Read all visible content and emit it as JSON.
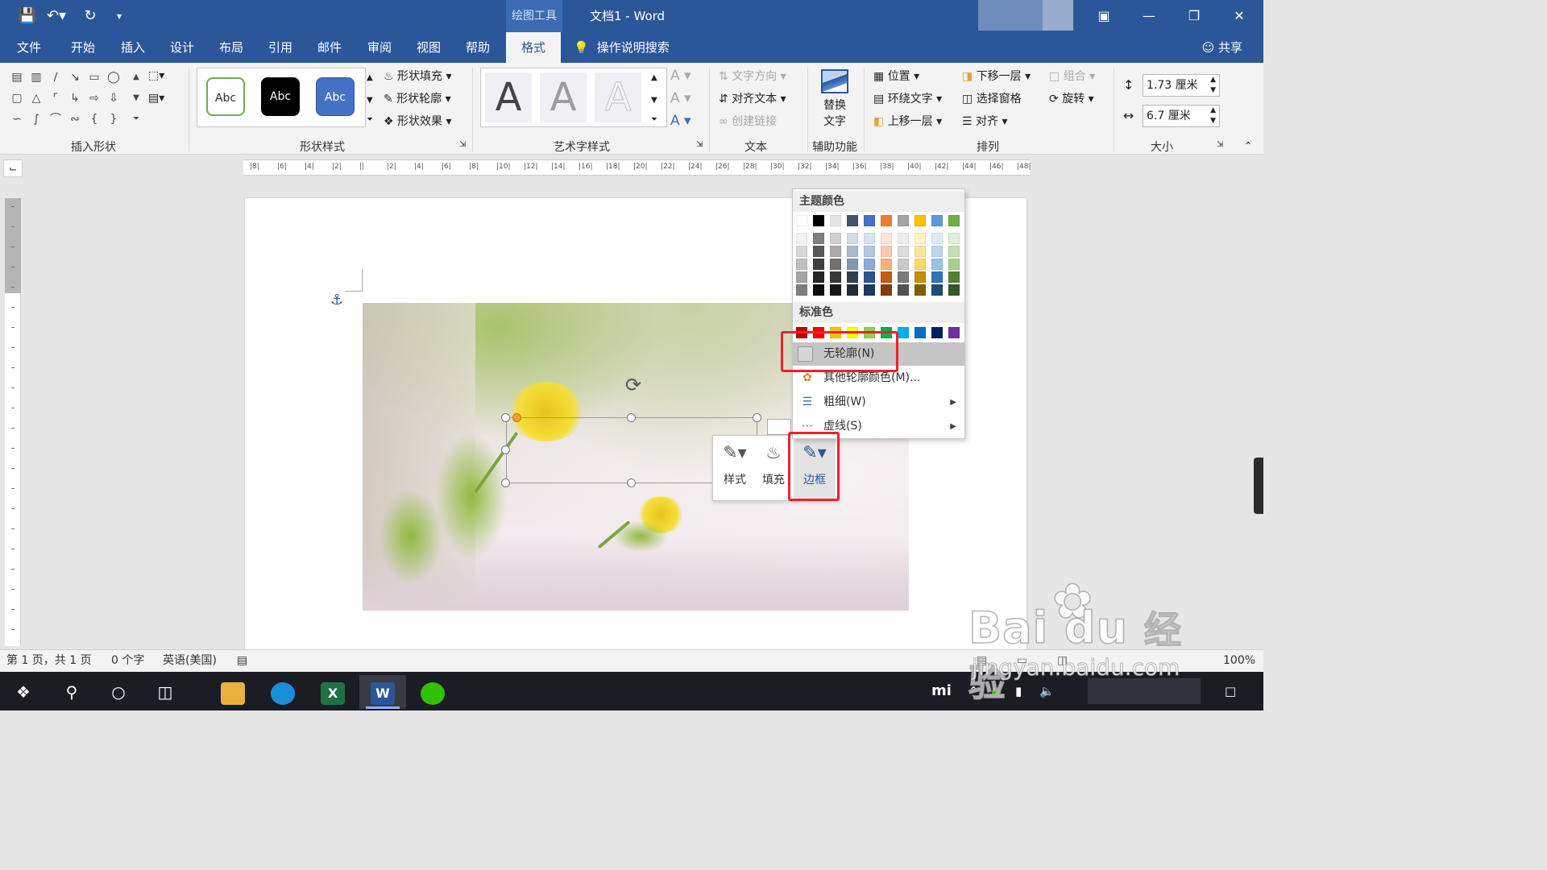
{
  "titlebar": {
    "quick_access": [
      "save-icon",
      "undo-icon",
      "redo-icon",
      "customize-icon"
    ],
    "context_group": "绘图工具",
    "doc_title": "文档1  -  Word"
  },
  "tabs": [
    {
      "label": "文件"
    },
    {
      "label": "开始"
    },
    {
      "label": "插入"
    },
    {
      "label": "设计"
    },
    {
      "label": "布局"
    },
    {
      "label": "引用"
    },
    {
      "label": "邮件"
    },
    {
      "label": "审阅"
    },
    {
      "label": "视图"
    },
    {
      "label": "帮助"
    },
    {
      "label": "格式",
      "active": true
    }
  ],
  "tellme": "操作说明搜索",
  "share": "共享",
  "ribbon": {
    "groups": {
      "insert_shapes": "插入形状",
      "shape_styles": "形状样式",
      "wordart": "艺术字样式",
      "text": "文本",
      "accessibility": "辅助功能",
      "arrange": "排列",
      "size": "大小"
    },
    "style_presets": [
      "Abc",
      "Abc",
      "Abc"
    ],
    "shape_fill": "形状填充",
    "shape_outline": "形状轮廓",
    "shape_effects": "形状效果",
    "text_direction": "文字方向",
    "align_text": "对齐文本",
    "create_link": "创建链接",
    "alt_text_1": "替换",
    "alt_text_2": "文字",
    "position": "位置",
    "wrap_text": "环绕文字",
    "bring_forward": "上移一层",
    "send_backward": "下移一层",
    "selection_pane": "选择窗格",
    "align": "对齐",
    "group": "组合",
    "rotate": "旋转",
    "height": "1.73 厘米",
    "width": "6.7 厘米"
  },
  "ruler_labels": [
    "8",
    "6",
    "4",
    "2",
    "",
    "2",
    "4",
    "6",
    "8",
    "10",
    "12",
    "14",
    "16",
    "18",
    "20",
    "22",
    "24",
    "26",
    "28",
    "30",
    "32",
    "34",
    "36",
    "38",
    "40",
    "42",
    "44",
    "46",
    "48"
  ],
  "mini_toolbar": {
    "style": "样式",
    "fill": "填充",
    "border": "边框"
  },
  "outline_menu": {
    "theme_colors_label": "主题颜色",
    "standard_colors_label": "标准色",
    "theme_top": [
      "#ffffff",
      "#000000",
      "#e7e6e6",
      "#44546a",
      "#4472c4",
      "#ed7d31",
      "#a5a5a5",
      "#ffc000",
      "#5b9bd5",
      "#70ad47"
    ],
    "theme_shades": [
      [
        "#f2f2f2",
        "#7f7f7f",
        "#d0cece",
        "#d6dce4",
        "#d9e2f3",
        "#fbe5d5",
        "#ededed",
        "#fff2cc",
        "#deebf6",
        "#e2efd9"
      ],
      [
        "#d8d8d8",
        "#595959",
        "#aeaaaa",
        "#adb9ca",
        "#b4c6e7",
        "#f7cbac",
        "#dbdbdb",
        "#fee599",
        "#bdd7ee",
        "#c5e0b3"
      ],
      [
        "#bfbfbf",
        "#3f3f3f",
        "#757070",
        "#8496b0",
        "#8eaadb",
        "#f4b183",
        "#c9c9c9",
        "#ffd965",
        "#9cc3e5",
        "#a8d08d"
      ],
      [
        "#a5a5a5",
        "#262626",
        "#3a3838",
        "#323f4f",
        "#2f5496",
        "#c55a11",
        "#7b7b7b",
        "#bf9000",
        "#2e75b5",
        "#538135"
      ],
      [
        "#7f7f7f",
        "#0c0c0c",
        "#171616",
        "#222a35",
        "#1f3864",
        "#833c0b",
        "#525252",
        "#7f6000",
        "#1e4e79",
        "#375623"
      ]
    ],
    "standard": [
      "#c00000",
      "#ff0000",
      "#ffc000",
      "#ffff00",
      "#92d050",
      "#00b050",
      "#00b0f0",
      "#0070c0",
      "#002060",
      "#7030a0"
    ],
    "no_outline": "无轮廓(N)",
    "more_colors": "其他轮廓颜色(M)...",
    "weight": "粗细(W)",
    "dashes": "虚线(S)"
  },
  "status": {
    "page": "第 1 页，共 1 页",
    "words": "0 个字",
    "lang": "英语(美国)",
    "zoom": "100%"
  },
  "watermark": {
    "brand": "Bai  du",
    "brand_cn": "经验",
    "url": "jingyan.baidu.com"
  },
  "taskbar": {
    "excel": "X",
    "word": "W",
    "tray_brand": "mi"
  },
  "colors": {
    "accent": "#2b579a",
    "highlight_red": "#e8232a"
  }
}
